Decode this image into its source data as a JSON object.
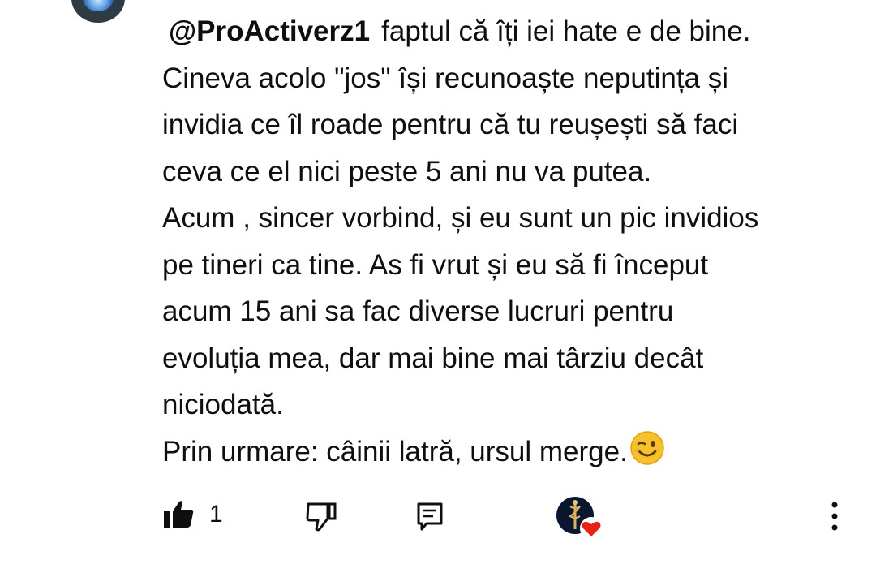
{
  "comment": {
    "mention": "@ProActiverz1",
    "lines": [
      "faptul că îți iei hate e de bine.",
      "Cineva acolo \"jos\" își recunoaște neputința și",
      "invidia ce îl roade pentru că tu reușești să faci",
      "ceva ce el nici peste 5 ani nu va putea.",
      "Acum , sincer vorbind, și eu sunt un pic invidios",
      "pe tineri ca tine. As fi vrut și eu să fi început",
      "acum 15 ani sa fac diverse lucruri pentru",
      "evoluția mea, dar mai bine mai târziu decât",
      "niciodată.",
      "Prin urmare: câinii latră, ursul merge."
    ],
    "trailing_emoji": "winking-face-emoji"
  },
  "actions": {
    "like_count": "1",
    "like_icon": "thumbs-up-filled-icon",
    "dislike_icon": "thumbs-down-outline-icon",
    "reply_icon": "reply-comment-icon",
    "creator_heart_icon": "red-heart-icon",
    "more_icon": "vertical-dots-icon"
  },
  "colors": {
    "text": "#0f0f0f",
    "heart": "#e62117",
    "emoji_face": "#f7c12b"
  }
}
